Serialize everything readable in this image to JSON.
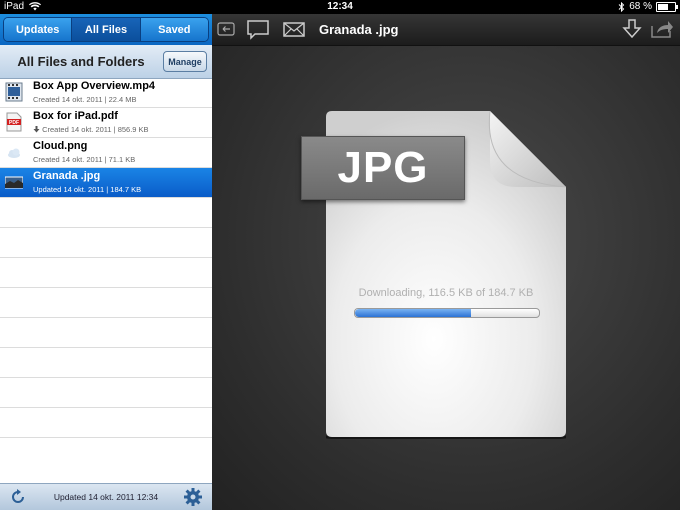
{
  "status_bar": {
    "device": "iPad",
    "time": "12:34",
    "battery": "68 %",
    "battery_level": 0.68,
    "icons": [
      "wifi-icon",
      "bluetooth-icon",
      "battery-icon"
    ]
  },
  "sidebar": {
    "tabs": [
      {
        "label": "Updates",
        "active": false
      },
      {
        "label": "All Files",
        "active": true
      },
      {
        "label": "Saved",
        "active": false
      }
    ],
    "header_title": "All Files and Folders",
    "manage_label": "Manage",
    "files": [
      {
        "name": "Box App Overview.mp4",
        "meta": "Created 14 okt. 2011 | 22.4 MB",
        "icon": "video-file-icon",
        "selected": false
      },
      {
        "name": "Box for iPad.pdf",
        "meta": "Created 14 okt. 2011 | 856.9 KB",
        "icon": "pdf-file-icon",
        "selected": false,
        "downloaded": true
      },
      {
        "name": "Cloud.png",
        "meta": "Created 14 okt. 2011 | 71.1 KB",
        "icon": "image-file-icon",
        "selected": false
      },
      {
        "name": "Granada .jpg",
        "meta": "Updated 14 okt. 2011 | 184.7 KB",
        "icon": "photo-thumbnail-icon",
        "selected": true
      }
    ],
    "footer_text": "Updated 14 okt. 2011 12:34"
  },
  "viewer": {
    "title": "Granada .jpg",
    "file_type": "JPG",
    "download_text": "Downloading, 116.5 KB of 184.7 KB",
    "progress": 0.63,
    "toolbar_icons": [
      "back-icon",
      "comment-icon",
      "email-icon",
      "download-icon",
      "share-icon"
    ]
  },
  "colors": {
    "accent_blue": "#0b66c2",
    "selection_blue": "#1a84e6",
    "progress_blue": "#2b72d4"
  }
}
